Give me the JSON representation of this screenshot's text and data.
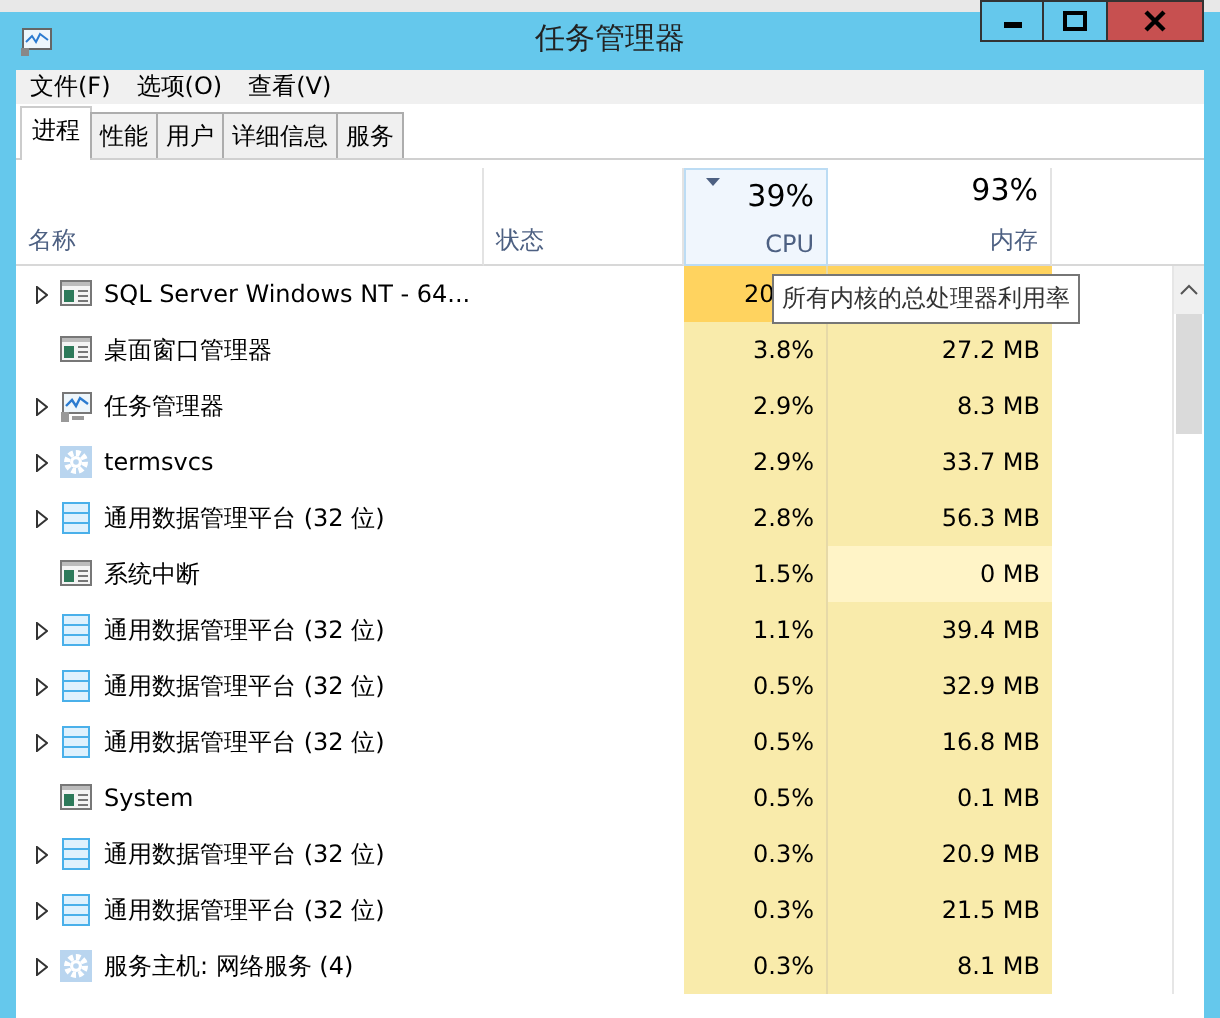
{
  "window": {
    "title": "任务管理器",
    "controls": [
      {
        "kind": "minimize"
      },
      {
        "kind": "maximize"
      },
      {
        "kind": "close"
      }
    ]
  },
  "menu": [
    "文件(F)",
    "选项(O)",
    "查看(V)"
  ],
  "tabs": [
    {
      "label": "进程",
      "selected": true
    },
    {
      "label": "性能",
      "selected": false
    },
    {
      "label": "用户",
      "selected": false
    },
    {
      "label": "详细信息",
      "selected": false
    },
    {
      "label": "服务",
      "selected": false
    }
  ],
  "table": {
    "columns": [
      {
        "label": "名称",
        "sorted": false,
        "hover": false
      },
      {
        "label": "状态",
        "sorted": false,
        "hover": false
      },
      {
        "label": "CPU",
        "total": "39%",
        "sorted": true,
        "hover": true
      },
      {
        "label": "内存",
        "total": "93%",
        "sorted": false,
        "hover": false
      }
    ],
    "rows": [
      {
        "name": "SQL Server Windows NT - 64...",
        "kind": "window",
        "expandable": true,
        "cpu": {
          "value": "20",
          "color": "#ffd35f"
        },
        "memory": {
          "color": "#ffd35f"
        }
      },
      {
        "name": "桌面窗口管理器",
        "kind": "window",
        "expandable": false,
        "cpu": {
          "value": "3.8%",
          "color": "#f9ebab"
        },
        "memory": {
          "value": "27.2 MB",
          "color": "#f9ebab"
        }
      },
      {
        "name": "任务管理器",
        "kind": "monitor",
        "expandable": true,
        "cpu": {
          "value": "2.9%",
          "color": "#f9ebab"
        },
        "memory": {
          "value": "8.3 MB",
          "color": "#f9ebab"
        }
      },
      {
        "name": "termsvcs",
        "kind": "service",
        "expandable": true,
        "cpu": {
          "value": "2.9%",
          "color": "#f9ebab"
        },
        "memory": {
          "value": "33.7 MB",
          "color": "#f9ebab"
        }
      },
      {
        "name": "通用数据管理平台 (32 位)",
        "kind": "app",
        "expandable": true,
        "cpu": {
          "value": "2.8%",
          "color": "#f9ebab"
        },
        "memory": {
          "value": "56.3 MB",
          "color": "#f9ebab"
        }
      },
      {
        "name": "系统中断",
        "kind": "window",
        "expandable": false,
        "cpu": {
          "value": "1.5%",
          "color": "#f9ebab"
        },
        "memory": {
          "value": "0 MB",
          "color": "#fff4c7"
        }
      },
      {
        "name": "通用数据管理平台 (32 位)",
        "kind": "app",
        "expandable": true,
        "cpu": {
          "value": "1.1%",
          "color": "#f9ebab"
        },
        "memory": {
          "value": "39.4 MB",
          "color": "#f9ebab"
        }
      },
      {
        "name": "通用数据管理平台 (32 位)",
        "kind": "app",
        "expandable": true,
        "cpu": {
          "value": "0.5%",
          "color": "#f9ebab"
        },
        "memory": {
          "value": "32.9 MB",
          "color": "#f9ebab"
        }
      },
      {
        "name": "通用数据管理平台 (32 位)",
        "kind": "app",
        "expandable": true,
        "cpu": {
          "value": "0.5%",
          "color": "#f9ebab"
        },
        "memory": {
          "value": "16.8 MB",
          "color": "#f9ebab"
        }
      },
      {
        "name": "System",
        "kind": "window",
        "expandable": false,
        "cpu": {
          "value": "0.5%",
          "color": "#f9ebab"
        },
        "memory": {
          "value": "0.1 MB",
          "color": "#f9ebab"
        }
      },
      {
        "name": "通用数据管理平台 (32 位)",
        "kind": "app",
        "expandable": true,
        "cpu": {
          "value": "0.3%",
          "color": "#f9ebab"
        },
        "memory": {
          "value": "20.9 MB",
          "color": "#f9ebab"
        }
      },
      {
        "name": "通用数据管理平台 (32 位)",
        "kind": "app",
        "expandable": true,
        "cpu": {
          "value": "0.3%",
          "color": "#f9ebab"
        },
        "memory": {
          "value": "21.5 MB",
          "color": "#f9ebab"
        }
      },
      {
        "name": "服务主机: 网络服务 (4)",
        "kind": "service",
        "expandable": true,
        "cpu": {
          "value": "0.3%",
          "color": "#f9ebab"
        },
        "memory": {
          "value": "8.1 MB",
          "color": "#f9ebab"
        }
      }
    ]
  },
  "tooltip": "所有内核的总处理器利用率"
}
